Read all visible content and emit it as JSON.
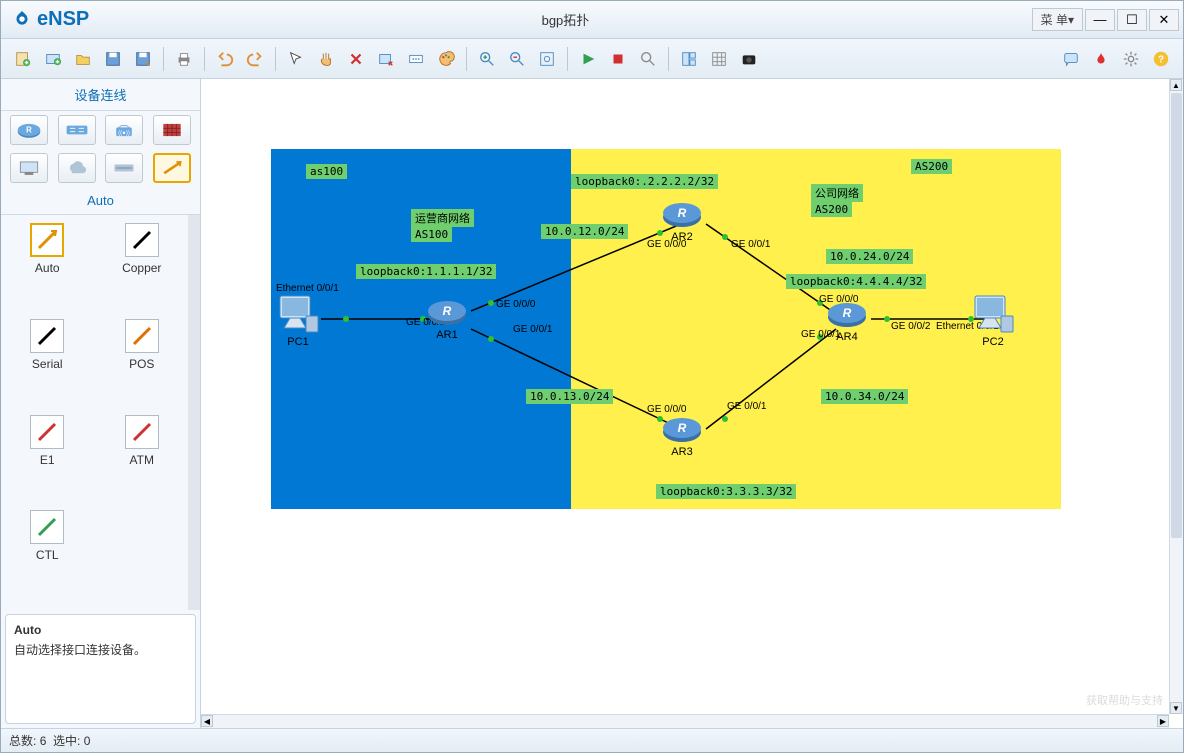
{
  "app": {
    "name": "eNSP",
    "title": "bgp拓扑",
    "menu_label": "菜 单▾"
  },
  "sidebar": {
    "header": "设备连线",
    "mode_header": "Auto",
    "links": [
      "Auto",
      "Copper",
      "Serial",
      "POS",
      "E1",
      "ATM",
      "CTL"
    ],
    "desc_title": "Auto",
    "desc_body": "自动选择接口连接设备。"
  },
  "status": {
    "total_label": "总数:",
    "total": "6",
    "sel_label": "选中:",
    "sel": "0"
  },
  "topology": {
    "zones": {
      "as100_tag": "as100",
      "isp_name": "运营商网络",
      "isp_as": "AS100",
      "as200_tag": "AS200",
      "corp_name": "公司网络",
      "corp_as": "AS200"
    },
    "nodes": {
      "pc1": "PC1",
      "pc2": "PC2",
      "ar1": "AR1",
      "ar2": "AR2",
      "ar3": "AR3",
      "ar4": "AR4"
    },
    "routes": {
      "lb1": "loopback0:1.1.1.1/32",
      "lb2": "loopback0:.2.2.2.2/32",
      "lb3": "loopback0:3.3.3.3/32",
      "lb4": "loopback0:4.4.4.4/32",
      "n12": "10.0.12.0/24",
      "n13": "10.0.13.0/24",
      "n24": "10.0.24.0/24",
      "n34": "10.0.34.0/24"
    },
    "ifaces": {
      "pc1": "Ethernet 0/0/1",
      "pc2_ge": "GE 0/0/2",
      "pc2_eth": "Ethernet 0/0/1",
      "ar1_g2": "GE 0/0/2",
      "ar1_g0": "GE 0/0/0",
      "ar1_g1": "GE 0/0/1",
      "ar2_g0": "GE 0/0/0",
      "ar2_g1": "GE 0/0/1",
      "ar3_g0": "GE 0/0/0",
      "ar3_g1": "GE 0/0/1",
      "ar4_g0": "GE 0/0/0",
      "ar4_g1": "GE 0/0/1"
    }
  },
  "watermark": "获取帮助与支持"
}
